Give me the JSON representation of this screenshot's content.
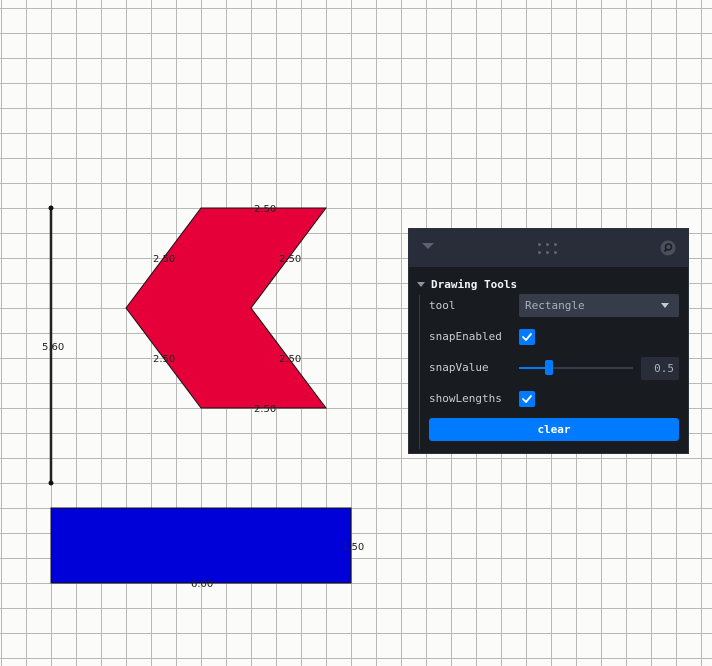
{
  "canvas": {
    "line_label": "5.60",
    "chevron_labels": [
      "2.50",
      "2.50",
      "2.50",
      "2.50",
      "2.50",
      "2.50"
    ],
    "rect_labels": [
      "6.00",
      "1.50"
    ],
    "colors": {
      "chevron": "#e5003a",
      "rectangle": "#0000d9",
      "line": "#222222"
    }
  },
  "panel": {
    "folder_title": "Drawing Tools",
    "tool": {
      "label": "tool",
      "value": "Rectangle"
    },
    "snap_enabled": {
      "label": "snapEnabled",
      "checked": true
    },
    "snap_value": {
      "label": "snapValue",
      "value": "0.5",
      "fraction": 0.26
    },
    "show_lengths": {
      "label": "showLengths",
      "checked": true
    },
    "clear_label": "clear",
    "icons": [
      "collapse-icon",
      "drag-handle-icon",
      "search-icon",
      "chevron-down-icon",
      "check-icon"
    ],
    "accent": "#007bff"
  }
}
